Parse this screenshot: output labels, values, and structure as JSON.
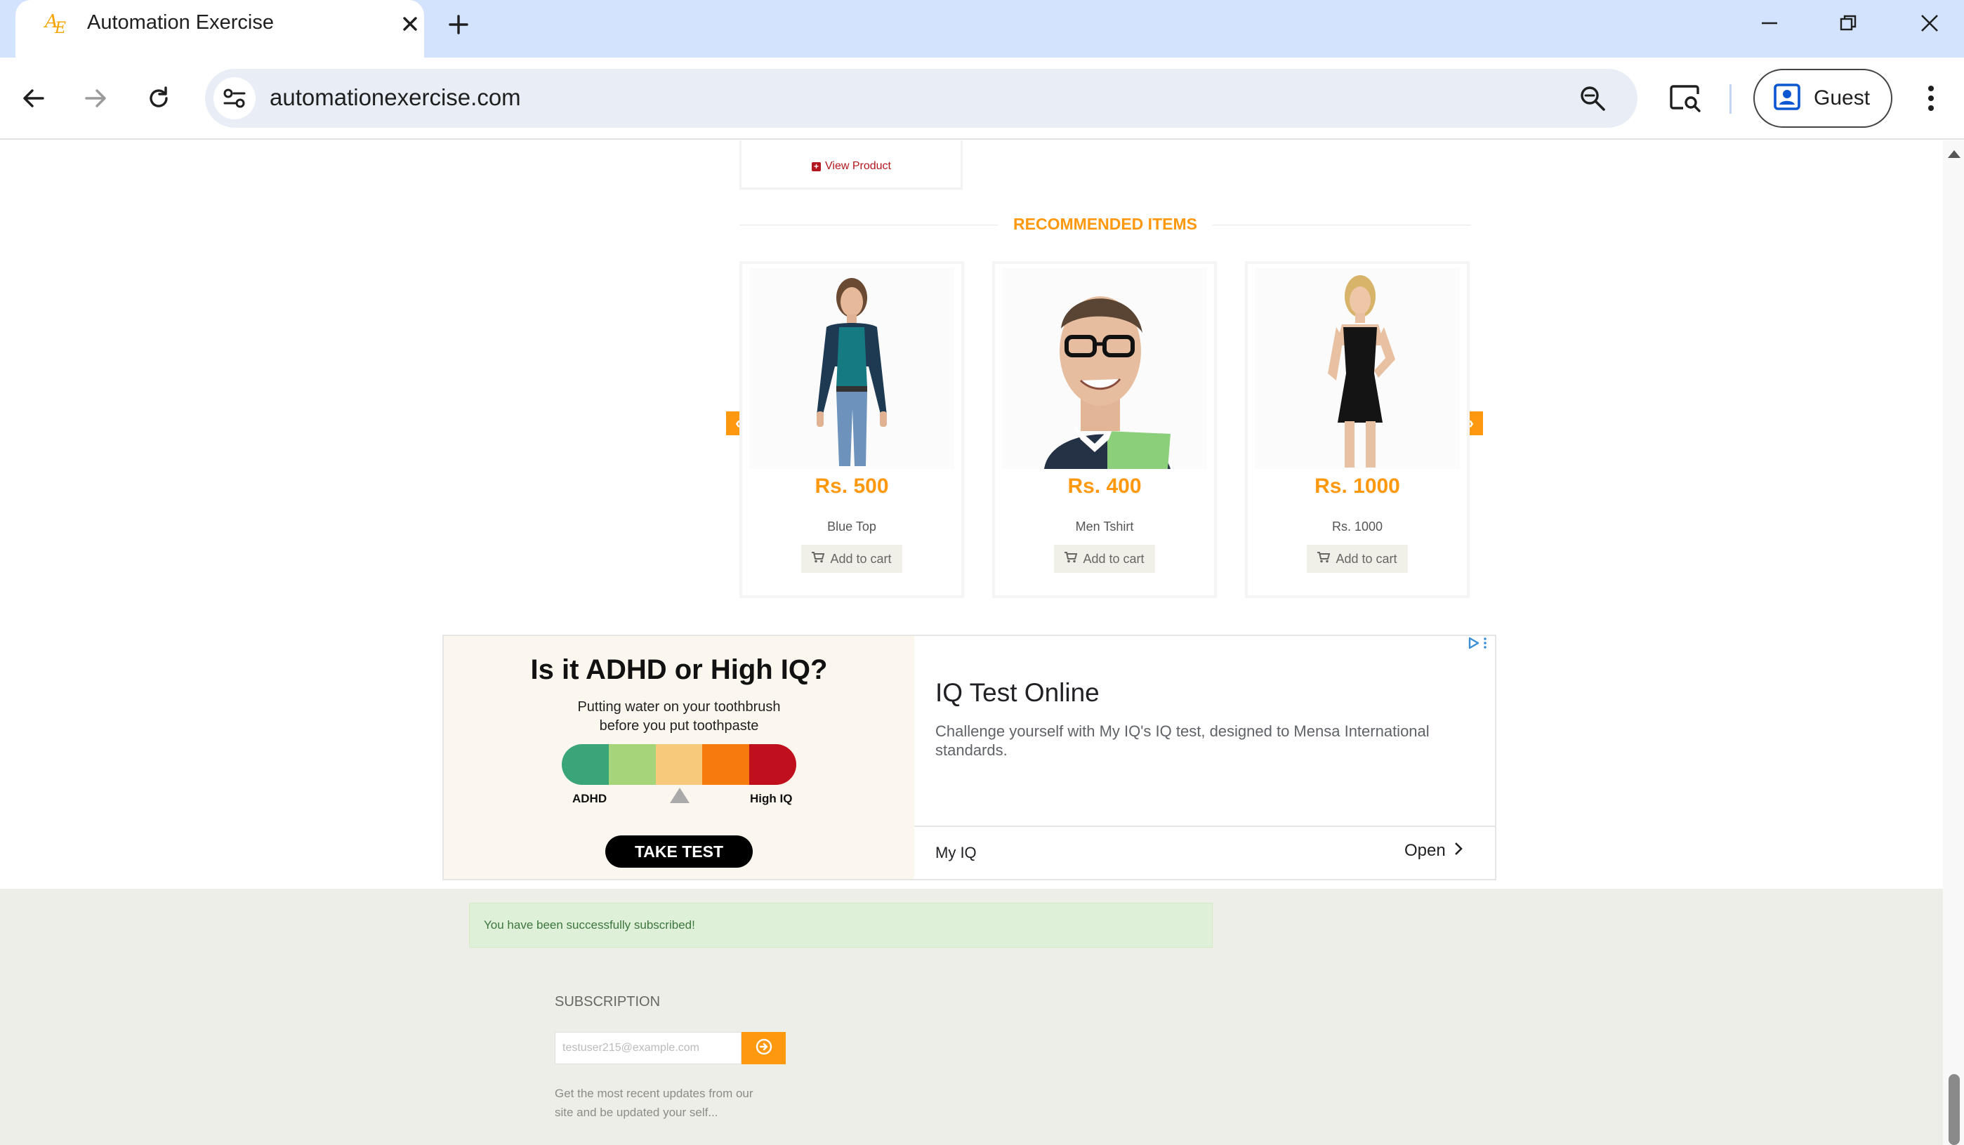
{
  "browser": {
    "tab_title": "Automation Exercise",
    "url": "automationexercise.com",
    "profile_label": "Guest"
  },
  "page": {
    "previous_card": {
      "view_product_label": "View Product"
    },
    "recommended": {
      "title": "RECOMMENDED ITEMS",
      "items": [
        {
          "price": "Rs. 500",
          "name": "Blue Top",
          "add_to_cart": "Add to cart"
        },
        {
          "price": "Rs. 400",
          "name": "Men Tshirt",
          "add_to_cart": "Add to cart"
        },
        {
          "price": "Rs. 1000",
          "name": "Rs. 1000",
          "add_to_cart": "Add to cart"
        }
      ]
    },
    "ad": {
      "headline": "Is it ADHD or High IQ?",
      "subline_1": "Putting water on your toothbrush",
      "subline_2": "before you put toothpaste",
      "label_left": "ADHD",
      "label_right": "High IQ",
      "cta": "TAKE TEST",
      "meter_colors": [
        "#3ba57a",
        "#a6d47a",
        "#f7c97a",
        "#f77a0e",
        "#c0101e"
      ],
      "title": "IQ Test Online",
      "description": "Challenge yourself with My IQ's IQ test, designed to Mensa International standards.",
      "advertiser": "My IQ",
      "open_label": "Open"
    },
    "footer": {
      "alert": "You have been successfully subscribed!",
      "subscription_title": "SUBSCRIPTION",
      "email_placeholder": "testuser215@example.com",
      "description": "Get the most recent updates from our site and be updated your self..."
    }
  },
  "colors": {
    "accent": "#fe980f",
    "tabstrip": "#d3e3fd",
    "footer_bg": "#eeeee8"
  }
}
